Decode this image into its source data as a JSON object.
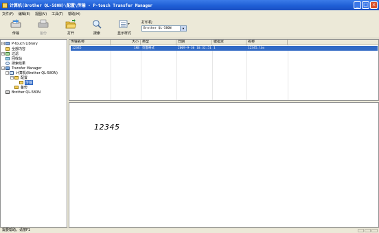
{
  "window": {
    "title": "计算机(Brother QL-580N)\\配置\\传输 - P-touch Transfer Manager",
    "minimize_glyph": "_",
    "maximize_glyph": "□",
    "close_glyph": "×"
  },
  "menu": {
    "items": [
      "文件(F)",
      "编辑(E)",
      "视图(V)",
      "工具(T)",
      "帮助(H)"
    ]
  },
  "toolbar": {
    "buttons": [
      {
        "label": "传输",
        "icon": "transfer-icon",
        "enabled": true
      },
      {
        "label": "备份",
        "icon": "backup-icon",
        "enabled": false
      },
      {
        "label": "打开",
        "icon": "open-icon",
        "enabled": true
      },
      {
        "label": "搜索",
        "icon": "search-icon",
        "enabled": true
      },
      {
        "label": "显示样式",
        "icon": "display-style-icon",
        "enabled": true
      }
    ],
    "printer_label": "打印机:",
    "printer_value": "Brother QL-580N"
  },
  "tree": {
    "items": [
      {
        "label": "P-touch Library",
        "icon": "library-icon",
        "expander": "−",
        "level": 0
      },
      {
        "label": "全部内容",
        "icon": "folder-icon",
        "expander": "",
        "level": 1
      },
      {
        "label": "过滤",
        "icon": "filter-icon",
        "expander": "+",
        "level": 1
      },
      {
        "label": "回收站",
        "icon": "recycle-bin-icon",
        "expander": "",
        "level": 1
      },
      {
        "label": "搜索结果",
        "icon": "search-icon",
        "expander": "",
        "level": 1
      },
      {
        "label": "Transfer Manager",
        "icon": "transfer-manager-icon",
        "expander": "−",
        "level": 0
      },
      {
        "label": "计算机(Brother QL-580N)",
        "icon": "computer-icon",
        "expander": "−",
        "level": 1
      },
      {
        "label": "配置",
        "icon": "folder-icon",
        "expander": "−",
        "level": 2
      },
      {
        "label": "传输",
        "icon": "folder-open-icon",
        "expander": "",
        "level": 3,
        "selected": true
      },
      {
        "label": "备份",
        "icon": "folder-icon",
        "expander": "",
        "level": 2
      },
      {
        "label": "Brother QL-580N",
        "icon": "printer-icon",
        "expander": "",
        "level": 1
      }
    ]
  },
  "file_list": {
    "columns": [
      "传输名称",
      "大小",
      "类型",
      "日期",
      "键指定",
      "名称"
    ],
    "rows": [
      {
        "transfer_name": "12345",
        "size": "1KB",
        "type": "页面格式",
        "date": "2009-9-30 10:32:51",
        "key_assign": "1",
        "name": "12345.lbx"
      }
    ]
  },
  "preview": {
    "text": "12345"
  },
  "status": {
    "text": "需要帮助，请按F1"
  },
  "colors": {
    "titlebar": "#1f5fd6",
    "selection": "#316ac5",
    "chrome": "#ece9d8"
  }
}
